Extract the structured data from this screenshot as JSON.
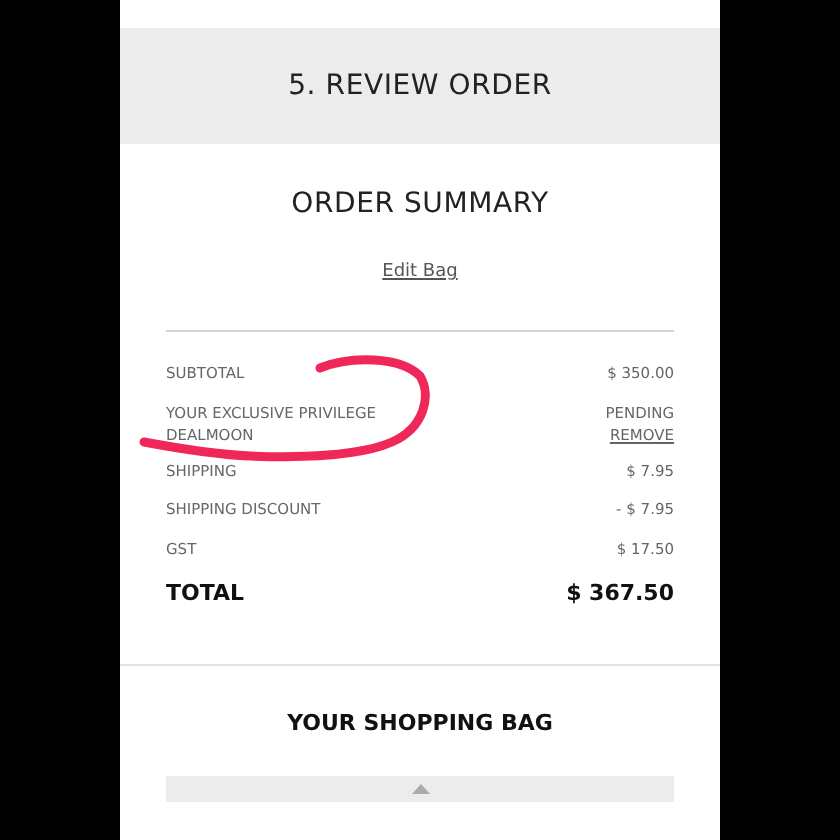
{
  "step_header": {
    "title": "5. REVIEW ORDER"
  },
  "order_summary": {
    "title": "ORDER SUMMARY",
    "edit_link": "Edit Bag",
    "rows": [
      {
        "kind": "line",
        "label": "SUBTOTAL",
        "value": "$ 350.00"
      },
      {
        "kind": "promo",
        "label": "YOUR EXCLUSIVE PRIVILEGE",
        "sublabel": "DEALMOON",
        "value": "PENDING",
        "link": "REMOVE"
      },
      {
        "kind": "line",
        "label": "SHIPPING",
        "value": "$ 7.95"
      },
      {
        "kind": "line",
        "label": "SHIPPING DISCOUNT",
        "value": "- $ 7.95"
      },
      {
        "kind": "line",
        "label": "GST",
        "value": "$ 17.50"
      },
      {
        "kind": "total",
        "label": "TOTAL",
        "value": "$ 367.50"
      }
    ]
  },
  "shopping_bag": {
    "title": "YOUR SHOPPING BAG"
  }
}
